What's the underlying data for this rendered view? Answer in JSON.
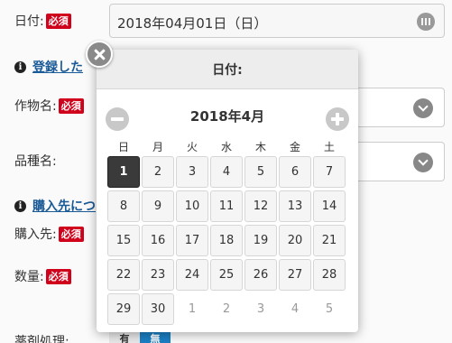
{
  "form": {
    "date_label": "日付:",
    "date_value": "2018年04月01日（日）",
    "required_badge": "必須",
    "info_link_1": "登録した",
    "crop_label": "作物名:",
    "variety_label": "品種名:",
    "info_link_2": "購入先につ",
    "supplier_label": "購入先:",
    "quantity_label": "数量:",
    "chemical_label": "薬剤処理:",
    "toggle_on": "有",
    "toggle_off": "無"
  },
  "picker": {
    "title": "日付:",
    "month_label": "2018年4月",
    "weekdays": [
      "日",
      "月",
      "火",
      "水",
      "木",
      "金",
      "土"
    ],
    "days": [
      {
        "label": "1",
        "selected": true,
        "outside": false
      },
      {
        "label": "2",
        "selected": false,
        "outside": false
      },
      {
        "label": "3",
        "selected": false,
        "outside": false
      },
      {
        "label": "4",
        "selected": false,
        "outside": false
      },
      {
        "label": "5",
        "selected": false,
        "outside": false
      },
      {
        "label": "6",
        "selected": false,
        "outside": false
      },
      {
        "label": "7",
        "selected": false,
        "outside": false
      },
      {
        "label": "8",
        "selected": false,
        "outside": false
      },
      {
        "label": "9",
        "selected": false,
        "outside": false
      },
      {
        "label": "10",
        "selected": false,
        "outside": false
      },
      {
        "label": "11",
        "selected": false,
        "outside": false
      },
      {
        "label": "12",
        "selected": false,
        "outside": false
      },
      {
        "label": "13",
        "selected": false,
        "outside": false
      },
      {
        "label": "14",
        "selected": false,
        "outside": false
      },
      {
        "label": "15",
        "selected": false,
        "outside": false
      },
      {
        "label": "16",
        "selected": false,
        "outside": false
      },
      {
        "label": "17",
        "selected": false,
        "outside": false
      },
      {
        "label": "18",
        "selected": false,
        "outside": false
      },
      {
        "label": "19",
        "selected": false,
        "outside": false
      },
      {
        "label": "20",
        "selected": false,
        "outside": false
      },
      {
        "label": "21",
        "selected": false,
        "outside": false
      },
      {
        "label": "22",
        "selected": false,
        "outside": false
      },
      {
        "label": "23",
        "selected": false,
        "outside": false
      },
      {
        "label": "24",
        "selected": false,
        "outside": false
      },
      {
        "label": "25",
        "selected": false,
        "outside": false
      },
      {
        "label": "26",
        "selected": false,
        "outside": false
      },
      {
        "label": "27",
        "selected": false,
        "outside": false
      },
      {
        "label": "28",
        "selected": false,
        "outside": false
      },
      {
        "label": "29",
        "selected": false,
        "outside": false
      },
      {
        "label": "30",
        "selected": false,
        "outside": false
      },
      {
        "label": "1",
        "selected": false,
        "outside": true
      },
      {
        "label": "2",
        "selected": false,
        "outside": true
      },
      {
        "label": "3",
        "selected": false,
        "outside": true
      },
      {
        "label": "4",
        "selected": false,
        "outside": true
      },
      {
        "label": "5",
        "selected": false,
        "outside": true
      }
    ]
  },
  "icons": {
    "date_field": "calendar-icon",
    "select": "chevron-down-icon",
    "close": "close-icon",
    "prev": "minus-circle-icon",
    "next": "plus-circle-icon",
    "info": "info-icon"
  },
  "colors": {
    "required_badge": "#d0021b",
    "link": "#1a5a96",
    "selected_day": "#3a3a3a",
    "toggle_active": "#1a7fc4"
  }
}
